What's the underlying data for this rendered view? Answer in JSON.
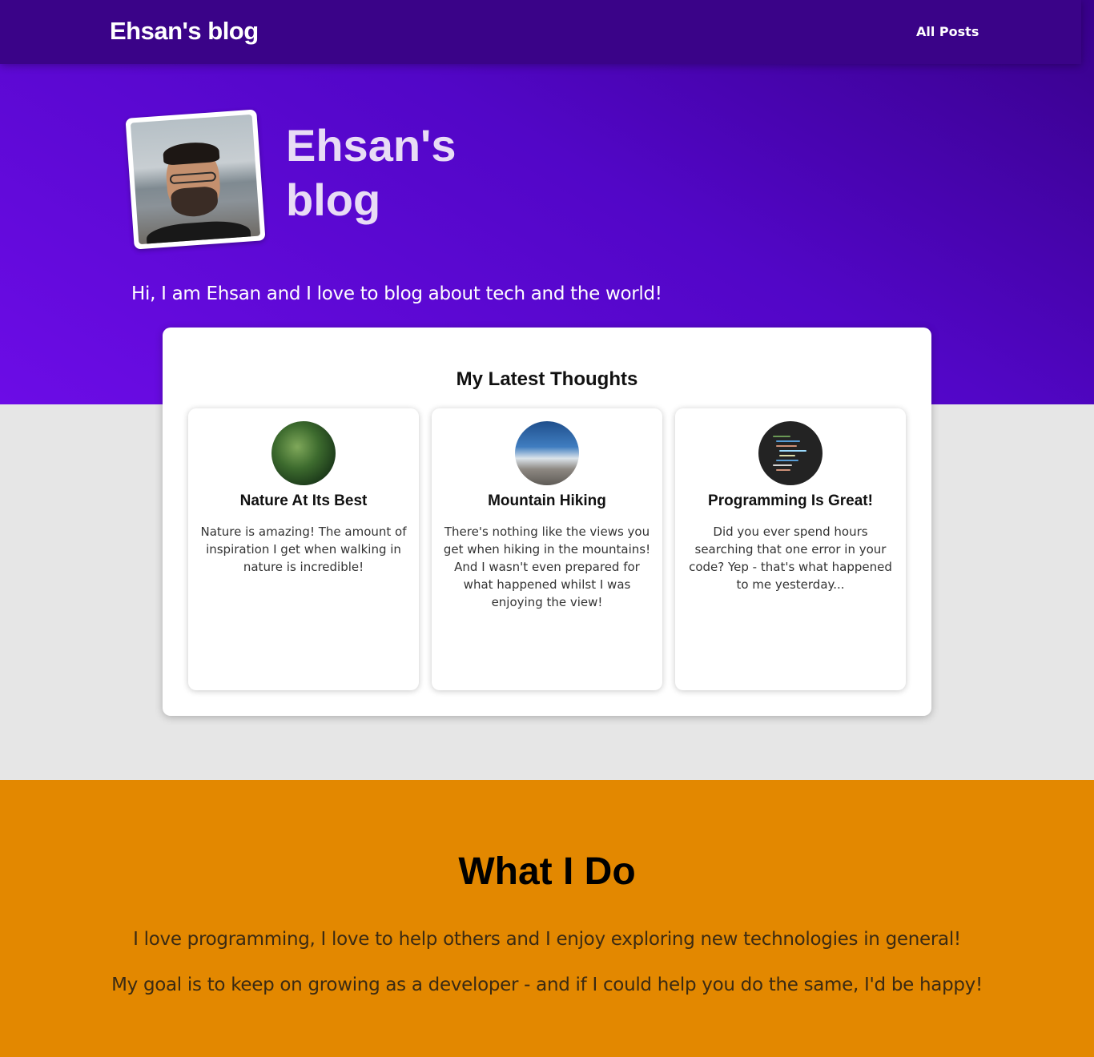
{
  "header": {
    "logo": "Ehsan's blog",
    "nav": [
      {
        "label": "All Posts"
      }
    ]
  },
  "hero": {
    "title": "Ehsan's blog",
    "tagline": "Hi, I am Ehsan and I love to blog about tech and the world!"
  },
  "latest": {
    "heading": "My Latest Thoughts",
    "posts": [
      {
        "title": "Nature At Its Best",
        "excerpt": "Nature is amazing! The amount of inspiration I get when walking in nature is incredible!"
      },
      {
        "title": "Mountain Hiking",
        "excerpt": "There's nothing like the views you get when hiking in the mountains! And I wasn't even prepared for what happened whilst I was enjoying the view!"
      },
      {
        "title": "Programming Is Great!",
        "excerpt": "Did you ever spend hours searching that one error in your code? Yep - that's what happened to me yesterday..."
      }
    ]
  },
  "what": {
    "heading": "What I Do",
    "paragraphs": [
      "I love programming, I love to help others and I enjoy exploring new technologies in general!",
      "My goal is to keep on growing as a developer - and if I could help you do the same, I'd be happy!"
    ]
  },
  "colors": {
    "header": "#3a0388",
    "hero_gradient_start": "#38018a",
    "hero_gradient_end": "#6c0ce6",
    "page_background": "#e6e6e6",
    "what_background": "#e38800"
  }
}
